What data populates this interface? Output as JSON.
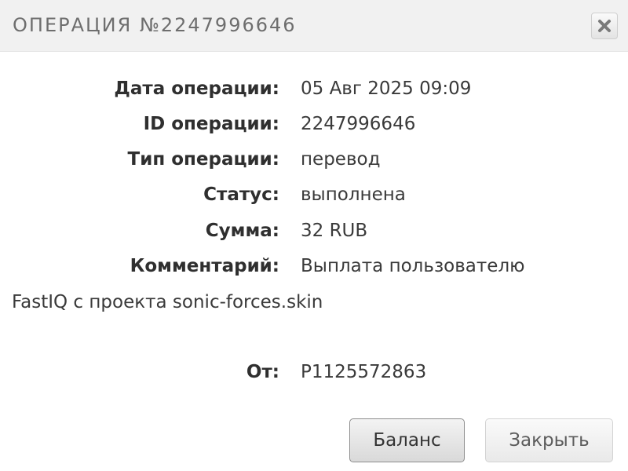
{
  "dialog": {
    "title": "ОПЕРАЦИЯ №2247996646",
    "close_icon": "close-icon"
  },
  "details": [
    {
      "label": "Дата операции:",
      "value": "05 Авг 2025 09:09"
    },
    {
      "label": "ID операции:",
      "value": "2247996646"
    },
    {
      "label": "Тип операции:",
      "value": "перевод"
    },
    {
      "label": "Статус:",
      "value": "выполнена"
    },
    {
      "label": "Сумма:",
      "value": "32 RUB"
    },
    {
      "label": "Комментарий:",
      "value": "Выплата пользователю",
      "continuation": "FastIQ с проекта sonic-forces.skin"
    },
    {
      "label": "От:",
      "value": "P1125572863"
    }
  ],
  "buttons": {
    "balance_label": "Баланс",
    "close_label": "Закрыть"
  },
  "colors": {
    "titlebar_bg": "#f1f1f1",
    "title_text": "#6e6e6e",
    "label_text": "#2f2f2f",
    "value_text": "#3a3a3a"
  }
}
